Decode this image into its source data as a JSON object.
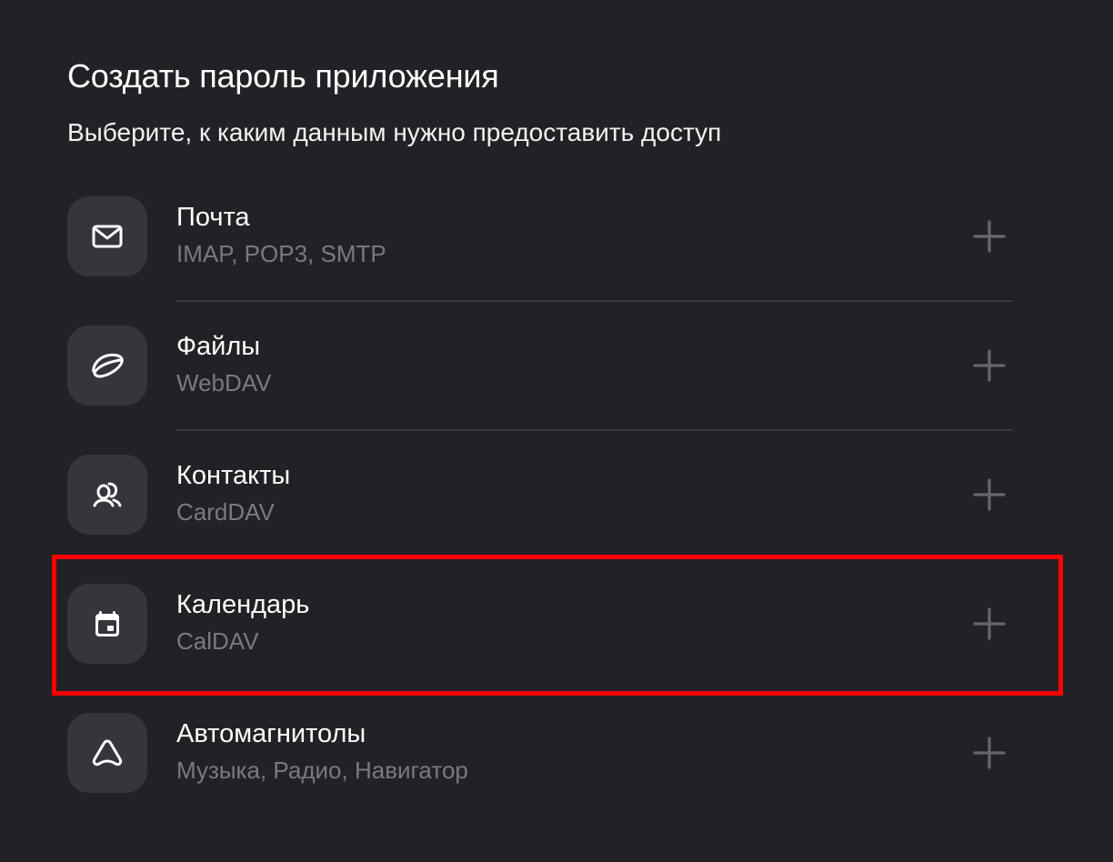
{
  "header": {
    "title": "Создать пароль приложения",
    "subtitle": "Выберите, к каким данным нужно предоставить доступ"
  },
  "items": [
    {
      "title": "Почта",
      "subtitle": "IMAP, POP3, SMTP",
      "icon": "mail-icon"
    },
    {
      "title": "Файлы",
      "subtitle": "WebDAV",
      "icon": "disk-icon"
    },
    {
      "title": "Контакты",
      "subtitle": "CardDAV",
      "icon": "contacts-icon"
    },
    {
      "title": "Календарь",
      "subtitle": "CalDAV",
      "icon": "calendar-icon"
    },
    {
      "title": "Автомагнитолы",
      "subtitle": "Музыка, Радио, Навигатор",
      "icon": "car-icon"
    }
  ],
  "colors": {
    "background": "#222126",
    "icon_tile": "#36353b",
    "secondary_text": "#7a797f",
    "highlight": "#ff0000"
  }
}
